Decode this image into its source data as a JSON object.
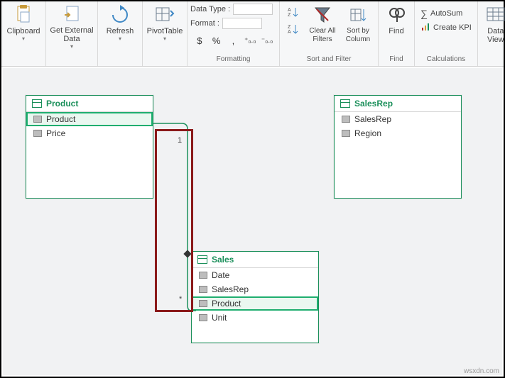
{
  "ribbon": {
    "clipboard": {
      "label": "Clipboard"
    },
    "getExternalData": {
      "label": "Get External\nData"
    },
    "refresh": {
      "label": "Refresh"
    },
    "pivotTable": {
      "label": "PivotTable"
    },
    "dataType": "Data Type :",
    "format": "Format :",
    "formatting_group": "Formatting",
    "fmt_dollar": "$",
    "fmt_percent": "%",
    "fmt_comma": ",",
    "fmt_inc": ".0",
    "fmt_dec": "0.",
    "sortAZ": "A→Z",
    "sortZA": "Z→A",
    "clearAll": "Clear All\nFilters",
    "sortBy": "Sort by\nColumn",
    "sortfilter_group": "Sort and Filter",
    "find": "Find",
    "find_group": "Find",
    "autosum": "AutoSum",
    "createKpi": "Create KPI",
    "calc_group": "Calculations",
    "dataView": "Data\nView"
  },
  "tables": {
    "product": {
      "title": "Product",
      "fields": [
        "Product",
        "Price"
      ]
    },
    "salesrep": {
      "title": "SalesRep",
      "fields": [
        "SalesRep",
        "Region"
      ]
    },
    "sales": {
      "title": "Sales",
      "fields": [
        "Date",
        "SalesRep",
        "Product",
        "Unit"
      ]
    }
  },
  "relationship": {
    "from_card": "1",
    "to_card": "*"
  },
  "watermark": "wsxdn.com"
}
